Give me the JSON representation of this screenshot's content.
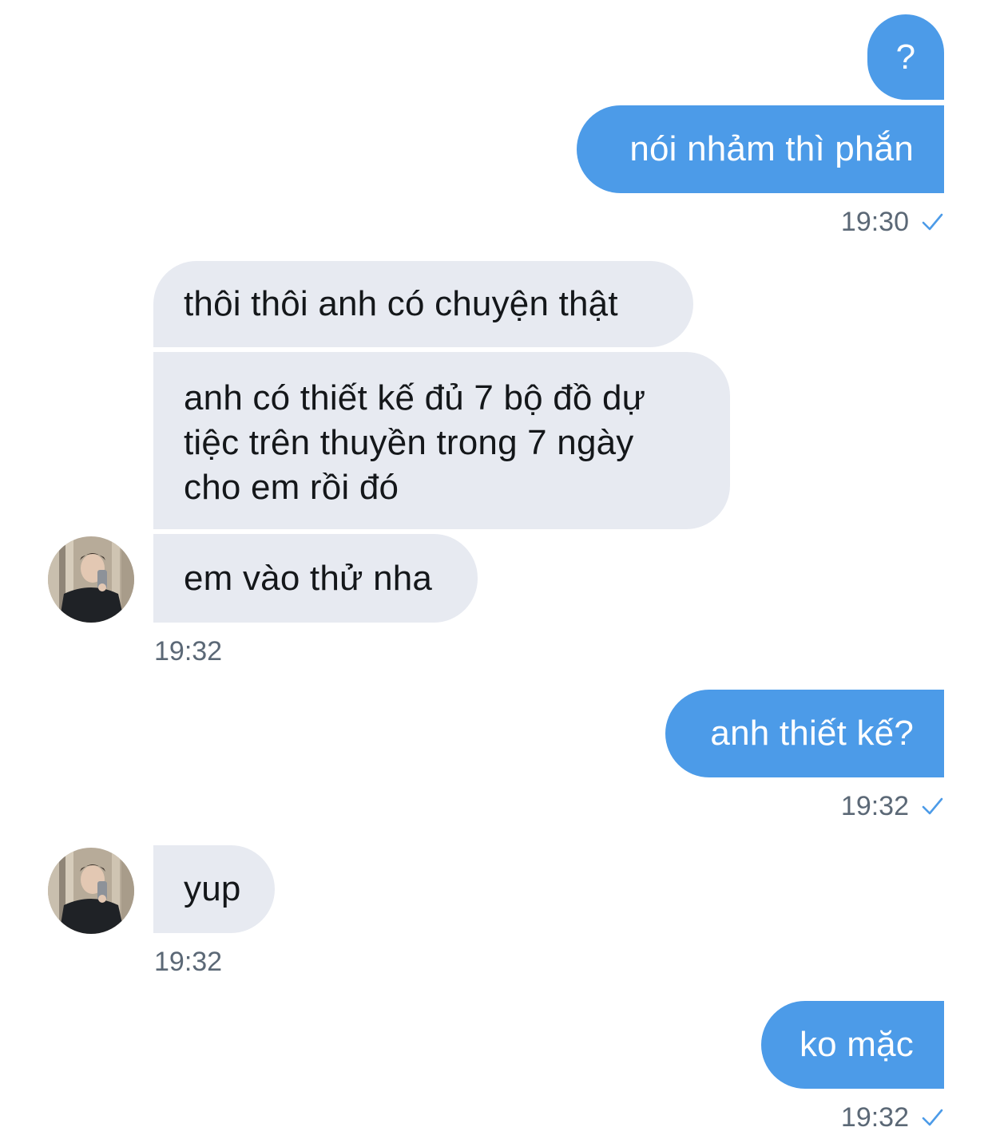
{
  "colors": {
    "sent_bubble": "#4c9be8",
    "received_bubble": "#e7eaf1",
    "timestamp": "#5b6876",
    "read_check": "#4c9be8"
  },
  "messages": {
    "m1": "?",
    "m2": "nói nhảm thì phắn",
    "m3": "thôi thôi anh có chuyện thật",
    "m4": "anh có thiết kế đủ 7 bộ đồ dự tiệc trên thuyền trong 7 ngày cho em rồi đó",
    "m5": "em vào thử nha",
    "m6": "anh thiết kế?",
    "m7": "yup",
    "m8": "ko mặc"
  },
  "timestamps": {
    "t1": "19:30",
    "t2": "19:32",
    "t3": "19:32",
    "t4": "19:32",
    "t5": "19:32"
  },
  "icons": {
    "read_receipt": "check-icon",
    "avatar": "avatar"
  }
}
